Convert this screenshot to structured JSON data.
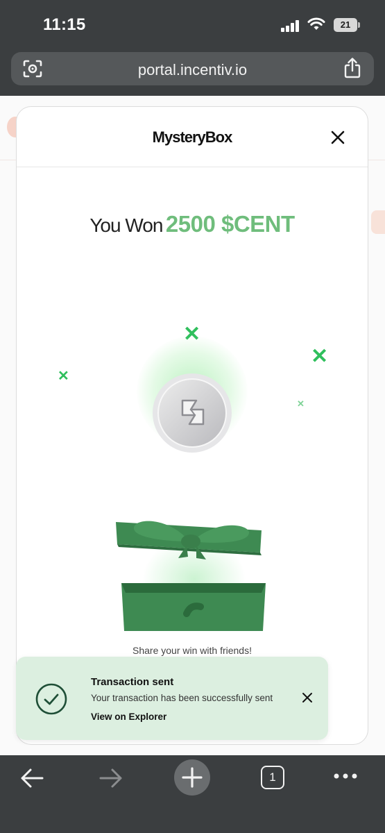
{
  "status_bar": {
    "time": "11:15",
    "battery": "21"
  },
  "browser": {
    "url": "portal.incentiv.io",
    "tabs_count": "1"
  },
  "modal": {
    "title": "MysteryBox",
    "won_prefix": "You Won",
    "won_amount": "2500 $CENT",
    "share_text": "Share your win with friends!"
  },
  "toast": {
    "title": "Transaction sent",
    "message": "Your transaction has been successfully sent",
    "link": "View on Explorer"
  },
  "colors": {
    "accent_green": "#6fbd7c",
    "sparkle_green": "#2fbf5c",
    "gift_green": "#3e8a52",
    "toast_bg": "#dcefe0",
    "browser_chrome": "#3b3e40"
  },
  "icons": [
    "signal-icon",
    "wifi-icon",
    "battery-icon",
    "scan-icon",
    "share-icon",
    "close-icon",
    "coin-icon",
    "gift-box-icon",
    "check-circle-icon",
    "back-arrow-icon",
    "forward-arrow-icon",
    "plus-icon",
    "tabs-icon",
    "more-icon"
  ]
}
